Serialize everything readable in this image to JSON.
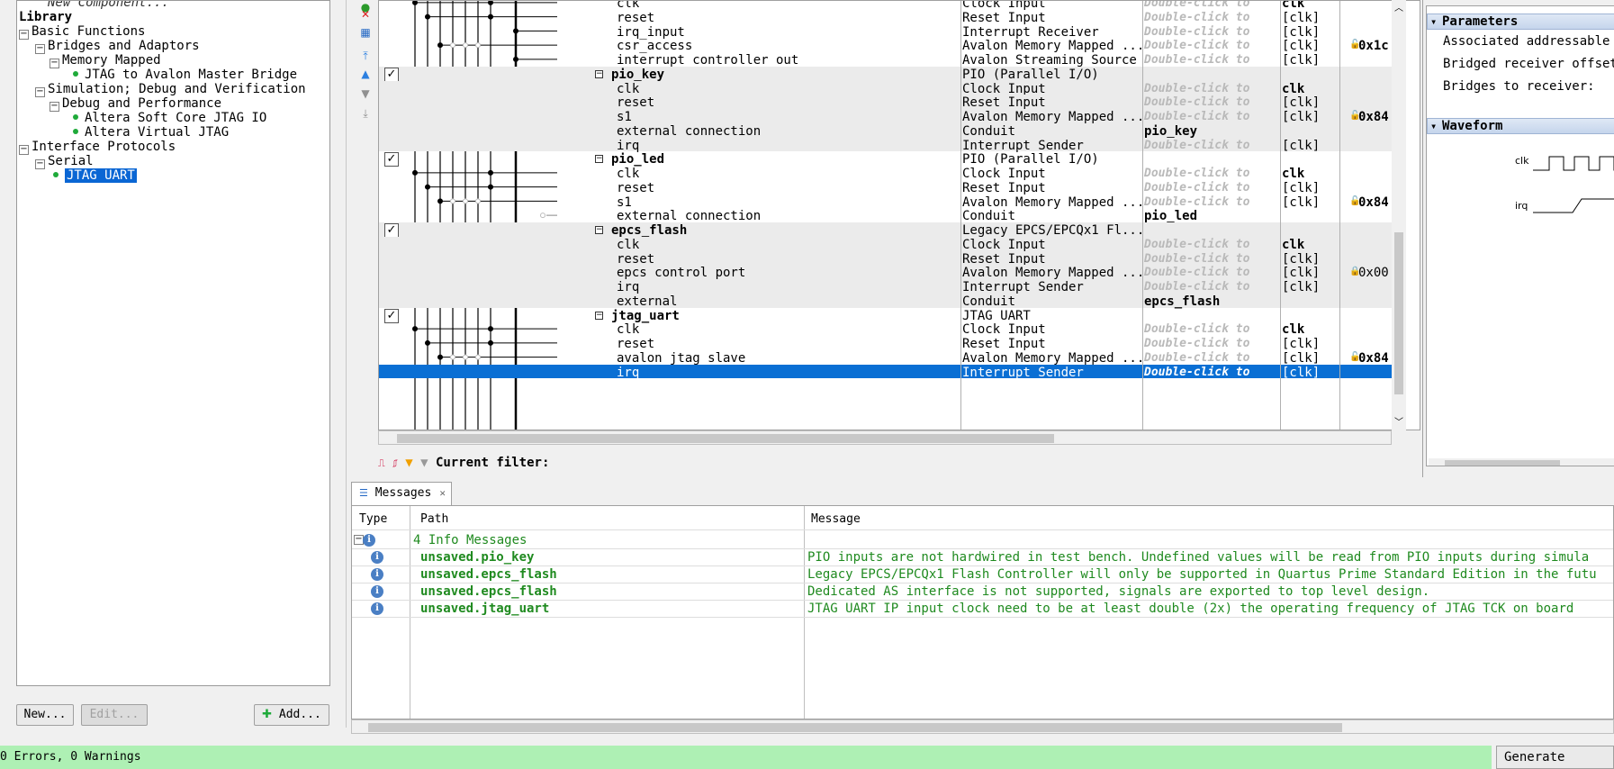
{
  "library": {
    "truncated_top": "New Component...",
    "title": "Library",
    "tree": [
      {
        "label": "Basic Functions",
        "toggle": "−",
        "level": 0
      },
      {
        "label": "Bridges and Adaptors",
        "toggle": "−",
        "level": 1
      },
      {
        "label": "Memory Mapped",
        "toggle": "−",
        "level": 2
      },
      {
        "label": "JTAG to Avalon Master Bridge",
        "toggle": "",
        "level": 3
      },
      {
        "label": "Simulation; Debug and Verification",
        "toggle": "−",
        "level": 1
      },
      {
        "label": "Debug and Performance",
        "toggle": "−",
        "level": 2
      },
      {
        "label": "Altera Soft Core JTAG IO",
        "toggle": "",
        "level": 3
      },
      {
        "label": "Altera Virtual JTAG",
        "toggle": "",
        "level": 3
      },
      {
        "label": "Interface Protocols",
        "toggle": "−",
        "level": 0
      },
      {
        "label": "Serial",
        "toggle": "−",
        "level": 1
      },
      {
        "label": "JTAG UART",
        "toggle": "",
        "level": 2,
        "selected": true
      }
    ],
    "buttons": {
      "new": "New...",
      "edit": "Edit...",
      "add": "Add..."
    }
  },
  "system": {
    "rows": [
      {
        "kind": "port",
        "name": "clk",
        "desc": "Clock Input",
        "exp": "Double-click to",
        "clk": "clk",
        "clk_bold": true,
        "base": ""
      },
      {
        "kind": "port",
        "name": "reset",
        "desc": "Reset Input",
        "exp": "Double-click to",
        "clk": "[clk]",
        "base": ""
      },
      {
        "kind": "port",
        "name": "irq_input",
        "desc": "Interrupt Receiver",
        "exp": "Double-click to",
        "clk": "[clk]",
        "base": ""
      },
      {
        "kind": "port",
        "name": "csr_access",
        "desc": "Avalon Memory Mapped ...",
        "exp": "Double-click to",
        "clk": "[clk]",
        "base": "0x1c",
        "lock": "open"
      },
      {
        "kind": "port",
        "name": "interrupt_controller_out",
        "desc": "Avalon Streaming Source",
        "exp": "Double-click to",
        "clk": "[clk]",
        "base": ""
      },
      {
        "kind": "comp",
        "name": "pio_key",
        "desc": "PIO (Parallel I/O)",
        "alt": true
      },
      {
        "kind": "port",
        "name": "clk",
        "desc": "Clock Input",
        "exp": "Double-click to",
        "clk": "clk",
        "clk_bold": true,
        "alt": true
      },
      {
        "kind": "port",
        "name": "reset",
        "desc": "Reset Input",
        "exp": "Double-click to",
        "clk": "[clk]",
        "alt": true
      },
      {
        "kind": "port",
        "name": "s1",
        "desc": "Avalon Memory Mapped ...",
        "exp": "Double-click to",
        "clk": "[clk]",
        "base": "0x84",
        "lock": "open",
        "alt": true
      },
      {
        "kind": "port",
        "name": "external_connection",
        "desc": "Conduit",
        "exp": "pio_key",
        "exp_val": true,
        "alt": true
      },
      {
        "kind": "port",
        "name": "irq",
        "desc": "Interrupt Sender",
        "exp": "Double-click to",
        "clk": "[clk]",
        "alt": true
      },
      {
        "kind": "comp",
        "name": "pio_led",
        "desc": "PIO (Parallel I/O)"
      },
      {
        "kind": "port",
        "name": "clk",
        "desc": "Clock Input",
        "exp": "Double-click to",
        "clk": "clk",
        "clk_bold": true
      },
      {
        "kind": "port",
        "name": "reset",
        "desc": "Reset Input",
        "exp": "Double-click to",
        "clk": "[clk]"
      },
      {
        "kind": "port",
        "name": "s1",
        "desc": "Avalon Memory Mapped ...",
        "exp": "Double-click to",
        "clk": "[clk]",
        "base": "0x84",
        "lock": "open"
      },
      {
        "kind": "port",
        "name": "external_connection",
        "desc": "Conduit",
        "exp": "pio_led",
        "exp_val": true
      },
      {
        "kind": "comp",
        "name": "epcs_flash",
        "desc": "Legacy EPCS/EPCQx1 Fl...",
        "alt": true
      },
      {
        "kind": "port",
        "name": "clk",
        "desc": "Clock Input",
        "exp": "Double-click to",
        "clk": "clk",
        "clk_bold": true,
        "alt": true
      },
      {
        "kind": "port",
        "name": "reset",
        "desc": "Reset Input",
        "exp": "Double-click to",
        "clk": "[clk]",
        "alt": true
      },
      {
        "kind": "port",
        "name": "epcs_control_port",
        "desc": "Avalon Memory Mapped ...",
        "exp": "Double-click to",
        "clk": "[clk]",
        "base": "0x00",
        "base_normal": true,
        "lock": "closed",
        "alt": true
      },
      {
        "kind": "port",
        "name": "irq",
        "desc": "Interrupt Sender",
        "exp": "Double-click to",
        "clk": "[clk]",
        "alt": true
      },
      {
        "kind": "port",
        "name": "external",
        "desc": "Conduit",
        "exp": "epcs_flash",
        "exp_val": true,
        "alt": true
      },
      {
        "kind": "comp",
        "name": "jtag_uart",
        "desc": "JTAG UART"
      },
      {
        "kind": "port",
        "name": "clk",
        "desc": "Clock Input",
        "exp": "Double-click to",
        "clk": "clk",
        "clk_bold": true
      },
      {
        "kind": "port",
        "name": "reset",
        "desc": "Reset Input",
        "exp": "Double-click to",
        "clk": "[clk]"
      },
      {
        "kind": "port",
        "name": "avalon_jtag_slave",
        "desc": "Avalon Memory Mapped ...",
        "exp": "Double-click to",
        "clk": "[clk]",
        "base": "0x84",
        "lock": "open"
      },
      {
        "kind": "port",
        "name": "irq",
        "desc": "Interrupt Sender",
        "exp": "Double-click to",
        "clk": "[clk]",
        "selected": true
      }
    ],
    "filter_label": "Current filter:"
  },
  "parameters": {
    "section_params": "Parameters",
    "rows": [
      "Associated addressable i",
      "Bridged receiver offset:",
      "Bridges to receiver:"
    ],
    "section_wave": "Waveform",
    "wave_signals": [
      "clk",
      "irq"
    ]
  },
  "messages": {
    "tab_label": "Messages",
    "columns": {
      "type": "Type",
      "path": "Path",
      "message": "Message"
    },
    "group_label": "4 Info Messages",
    "items": [
      {
        "path": "unsaved.pio_key",
        "text": "PIO inputs are not hardwired in test bench. Undefined values will be read from PIO inputs during simula"
      },
      {
        "path": "unsaved.epcs_flash",
        "text": "Legacy EPCS/EPCQx1 Flash Controller will only be supported in Quartus Prime Standard Edition in the futu"
      },
      {
        "path": "unsaved.epcs_flash",
        "text": "Dedicated AS interface is not supported, signals are exported to top level design."
      },
      {
        "path": "unsaved.jtag_uart",
        "text": "JTAG UART IP input clock need to be at least double (2x) the operating frequency of JTAG TCK on board"
      }
    ]
  },
  "status": {
    "text": "0 Errors, 0 Warnings",
    "generate": "Generate HDL..."
  }
}
